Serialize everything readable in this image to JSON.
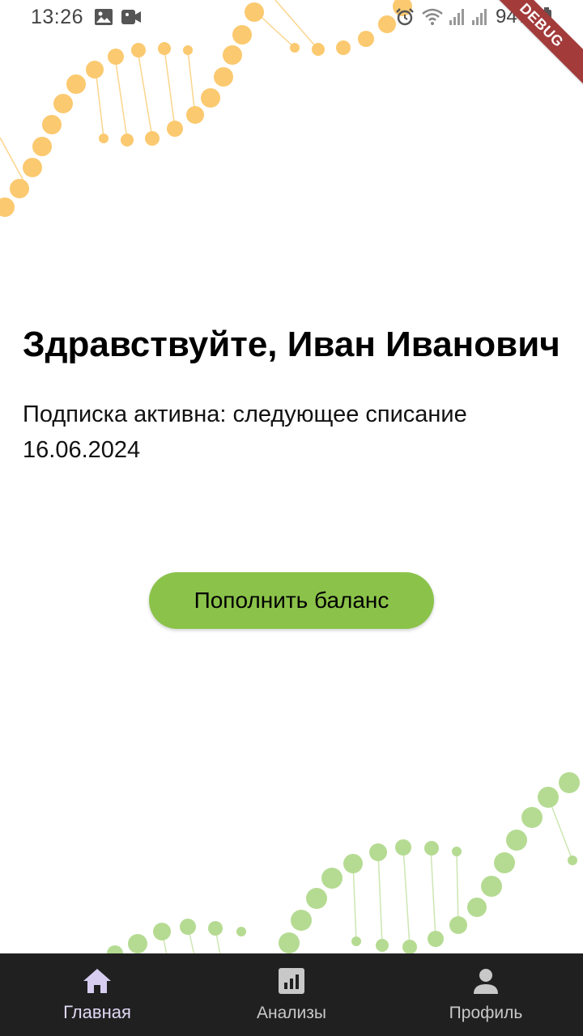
{
  "status_bar": {
    "time": "13:26",
    "battery": "94%",
    "icons": [
      "image-icon",
      "video-icon",
      "alarm-icon",
      "wifi-icon",
      "signal-icon",
      "signal-icon",
      "battery-icon"
    ]
  },
  "debug_banner": "DEBUG",
  "home": {
    "greeting": "Здравствуйте, Иван Иванович",
    "subscription_status": "Подписка активна: следующее списание 16.06.2024",
    "topup_button": "Пополнить баланс"
  },
  "bottom_nav": {
    "items": [
      {
        "label": "Главная",
        "icon": "home-icon",
        "active": true
      },
      {
        "label": "Анализы",
        "icon": "chart-icon",
        "active": false
      },
      {
        "label": "Профиль",
        "icon": "person-icon",
        "active": false
      }
    ]
  },
  "colors": {
    "accent_green": "#8bc34a",
    "dna_orange": "#fbc96f",
    "dna_green": "#b5db92",
    "nav_background": "#202021"
  }
}
